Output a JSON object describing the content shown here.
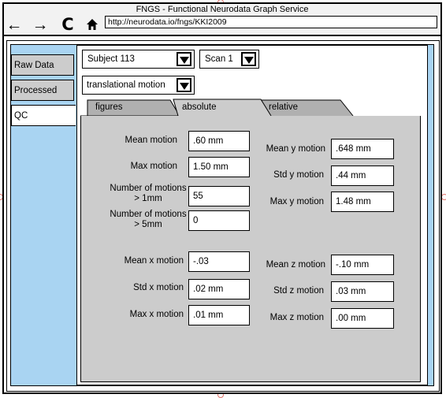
{
  "window": {
    "title": "FNGS - Functional Neurodata Graph Service",
    "url": "http://neurodata.io/fngs/KKI2009"
  },
  "nav": {
    "back": "←",
    "forward": "→",
    "reload": "C",
    "home": "⌂"
  },
  "sidebar": {
    "items": [
      {
        "label": "Raw Data"
      },
      {
        "label": "Processed"
      },
      {
        "label": "QC"
      }
    ]
  },
  "selectors": {
    "subject": "Subject 113",
    "scan": "Scan 1",
    "metric": "translational motion"
  },
  "tabs": [
    {
      "label": "figures"
    },
    {
      "label": "absolute"
    },
    {
      "label": "relative"
    }
  ],
  "fields": {
    "mean_motion": {
      "label": "Mean motion",
      "value": ".60 mm"
    },
    "max_motion": {
      "label": "Max motion",
      "value": "1.50 mm"
    },
    "motions_gt_1mm": {
      "label": "Number of motions > 1mm",
      "value": "55"
    },
    "motions_gt_5mm": {
      "label": "Number of motions > 5mm",
      "value": "0"
    },
    "mean_y": {
      "label": "Mean y motion",
      "value": ".648 mm"
    },
    "std_y": {
      "label": "Std y motion",
      "value": ".44 mm"
    },
    "max_y": {
      "label": "Max y motion",
      "value": "1.48 mm"
    },
    "mean_x": {
      "label": "Mean x motion",
      "value": "-.03"
    },
    "std_x": {
      "label": "Std x motion",
      "value": ".02 mm"
    },
    "max_x": {
      "label": "Max x motion",
      "value": ".01 mm"
    },
    "mean_z": {
      "label": "Mean z motion",
      "value": "-.10 mm"
    },
    "std_z": {
      "label": "Std z motion",
      "value": ".03 mm"
    },
    "max_z": {
      "label": "Max z motion",
      "value": ".00 mm"
    }
  },
  "colors": {
    "frame_blue": "#a9d4f2",
    "panel_gray": "#cccccc",
    "tab_gray": "#b0b0b0",
    "handle": "#e0736b"
  }
}
